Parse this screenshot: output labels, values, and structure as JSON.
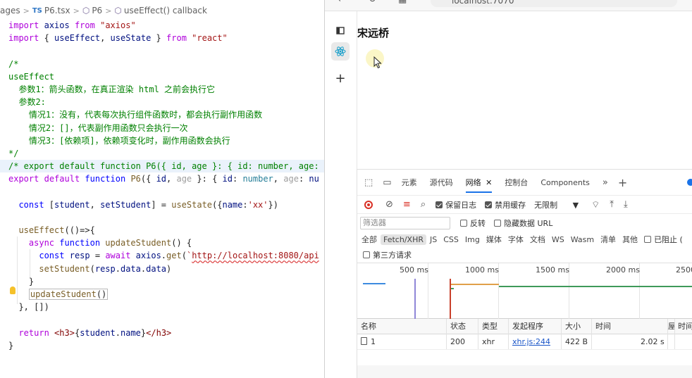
{
  "editor": {
    "breadcrumb": {
      "folder": "ages",
      "file_lang": "TS",
      "file": "P6.tsx",
      "component": "P6",
      "callback": "useEffect() callback"
    },
    "lines": [
      "import axios from \"axios\"",
      "import { useEffect, useState } from \"react\"",
      "",
      "/*",
      "useEffect",
      "  参数1：箭头函数，在真正渲染 html 之前会执行它",
      "  参数2:",
      "    情况1：没有，代表每次执行组件函数时，都会执行副作用函数",
      "    情况2：[]，代表副作用函数只会执行一次",
      "    情况3：[依赖项]，依赖项变化时，副作用函数会执行",
      "*/",
      "/* export default function P6({ id, age }: { id: number, age:",
      "export default function P6({ id, age }: { id: number, age: nu",
      "",
      "  const [student, setStudent] = useState({name:'xx'})",
      "",
      "  useEffect(()=>{",
      "    async function updateStudent() {",
      "      const resp = await axios.get(`http://localhost:8080/api",
      "      setStudent(resp.data.data)",
      "    }",
      "    updateStudent()",
      "  }, [])",
      "",
      "  return <h3>{student.name}</h3>",
      "}"
    ]
  },
  "browser": {
    "address": "localhost:7070",
    "page_heading": "宋远桥",
    "side_icons": [
      "tab-icon",
      "react-icon",
      "add-icon"
    ]
  },
  "devtools": {
    "tabs": [
      "元素",
      "源代码",
      "网络",
      "控制台",
      "Components"
    ],
    "active_tab": "网络",
    "toolbar": {
      "preserve_log": "保留日志",
      "disable_cache": "禁用缓存",
      "throttle": "无限制"
    },
    "filter": {
      "placeholder": "筛选器",
      "invert": "反转",
      "hide_data_urls": "隐藏数据 URL"
    },
    "types": [
      "全部",
      "Fetch/XHR",
      "JS",
      "CSS",
      "Img",
      "媒体",
      "字体",
      "文档",
      "WS",
      "Wasm",
      "清单",
      "其他"
    ],
    "active_type": "Fetch/XHR",
    "blocked": "已阻止 (",
    "third_party": "第三方请求",
    "timeline_ticks": [
      "500 ms",
      "1000 ms",
      "1500 ms",
      "2000 ms",
      "2500"
    ],
    "columns": [
      "名称",
      "状态",
      "类型",
      "发起程序",
      "大小",
      "时间",
      "屋",
      "时间"
    ],
    "request": {
      "name": "1",
      "status": "200",
      "type": "xhr",
      "initiator": "xhr.js:244",
      "size": "422 B",
      "time": "2.02 s"
    }
  }
}
